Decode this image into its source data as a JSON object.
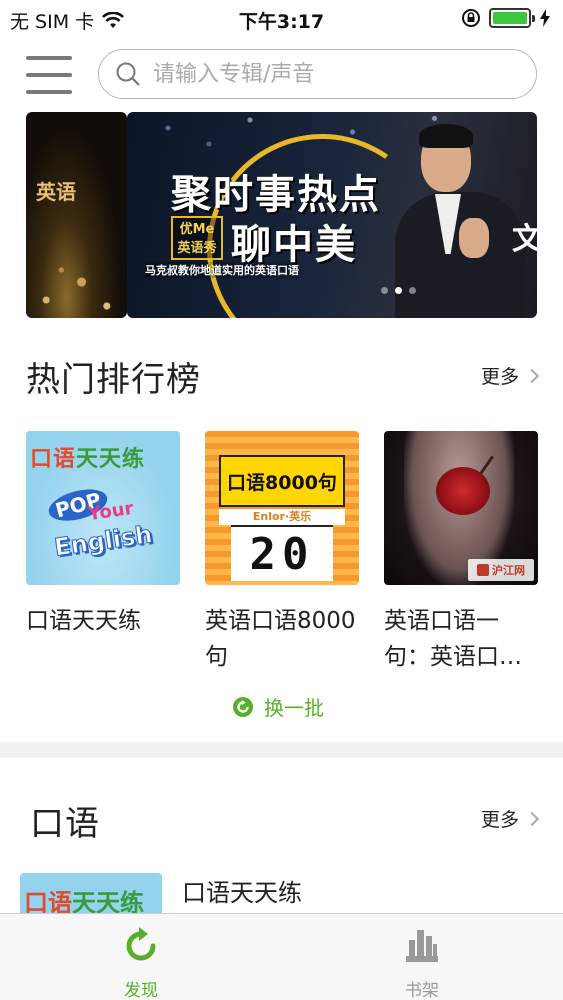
{
  "status_bar": {
    "carrier": "无 SIM 卡",
    "time": "下午3:17",
    "battery_level": 1.0
  },
  "header": {
    "menu_icon": "hamburger-menu-icon",
    "search_placeholder": "请输入专辑/声音"
  },
  "banner": {
    "prev_label": "英语",
    "title_line1": "聚时事热点",
    "title_line2": "聊中美",
    "badge_line1": "优Me",
    "badge_line2": "英语秀",
    "subtitle": "马克叔教你地道实用的英语口语",
    "next_text": "文",
    "active_slide": 1,
    "slide_count": 3
  },
  "hot_section": {
    "title": "热门排行榜",
    "more_label": "更多",
    "items": [
      {
        "title": "口语天天练",
        "cover": {
          "title_a": "口语",
          "title_b": "天天练",
          "pop": "POP",
          "your": "Your",
          "english": "English"
        }
      },
      {
        "title": "英语口语8000句",
        "cover": {
          "top": "口语8000句",
          "brand": "Enlor·英乐",
          "number": "20"
        }
      },
      {
        "title": "英语口语一句：英语口…",
        "cover": {
          "logo": "沪江网"
        }
      }
    ],
    "refresh_label": "换一批"
  },
  "oral_section": {
    "title": "口语",
    "more_label": "更多",
    "items": [
      {
        "title": "口语天天练",
        "cover_a": "口语",
        "cover_b": "天天练"
      }
    ]
  },
  "tab_bar": {
    "tabs": [
      {
        "label": "发现",
        "icon": "discover-refresh-icon",
        "active": true,
        "color": "#5aaf2a"
      },
      {
        "label": "书架",
        "icon": "bookshelf-icon",
        "active": false,
        "color": "#999999"
      }
    ]
  },
  "colors": {
    "accent_green": "#5aaf2a",
    "battery_green": "#3cc83c",
    "text_dark": "#222222",
    "inactive_gray": "#999999"
  }
}
